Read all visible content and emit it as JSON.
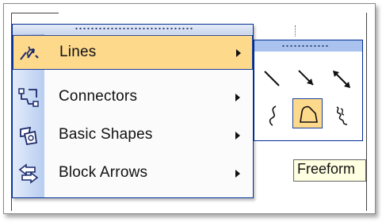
{
  "menu": {
    "items": [
      {
        "label": "Lines",
        "icon": "lines-icon",
        "highlighted": true
      },
      {
        "label": "Connectors",
        "icon": "connectors-icon",
        "highlighted": false
      },
      {
        "label": "Basic Shapes",
        "icon": "basic-shapes-icon",
        "highlighted": false
      },
      {
        "label": "Block Arrows",
        "icon": "block-arrows-icon",
        "highlighted": false
      }
    ]
  },
  "palette": {
    "tools": [
      {
        "icon": "line-icon",
        "selected": false
      },
      {
        "icon": "arrow-icon",
        "selected": false
      },
      {
        "icon": "double-arrow-icon",
        "selected": false
      },
      {
        "icon": "curve-icon",
        "selected": false
      },
      {
        "icon": "freeform-icon",
        "selected": true
      },
      {
        "icon": "scribble-icon",
        "selected": false
      }
    ]
  },
  "tooltip": {
    "text": "Freeform"
  },
  "colors": {
    "highlight": "#fdd98c",
    "menu_border": "#002d96",
    "gutter_start": "#e4ecfb",
    "gutter_end": "#b7cdf0",
    "tooltip_bg": "#ffffe1"
  }
}
